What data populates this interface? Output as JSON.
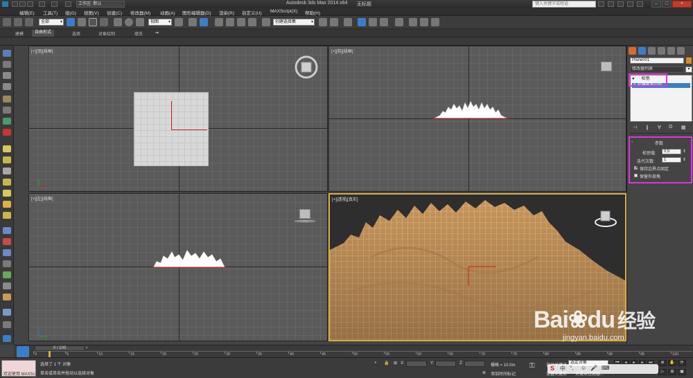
{
  "titlebar": {
    "workspace": "工作区: 默认",
    "app_title": "Autodesk 3ds Max  2014 x64",
    "doc_title": "无标题",
    "search_placeholder": "键入关键字或短语",
    "win_min": "–",
    "win_max": "□",
    "win_close": "×"
  },
  "menu": [
    "编辑(E)",
    "工具(T)",
    "组(G)",
    "视图(V)",
    "创建(C)",
    "修改器(M)",
    "动画(A)",
    "图形编辑器(D)",
    "渲染(R)",
    "自定义(U)",
    "MAXScript(X)",
    "帮助(H)"
  ],
  "toolbar": {
    "filter_select": "全部",
    "ref_coord_select": "视图",
    "named_selection_placeholder": "创建选择集"
  },
  "ribbon_tabs": [
    "建模",
    "自由形式",
    "选择",
    "对象绘制",
    "填充"
  ],
  "viewports": {
    "top": "[+][顶][线框]",
    "front": "[+][前][线框]",
    "left": "[+][左][线框]",
    "perspective": "[+][透视][真实]"
  },
  "command_panel": {
    "object_name": "Plane001",
    "modifier_list": "修改器列表",
    "stack_items": [
      "松弛",
      "可编辑多边形"
    ],
    "rollout_title": "参数",
    "relax_label": "松弛值:",
    "relax_value": "0.5",
    "iter_label": "迭代次数:",
    "iter_value": "1",
    "keep_boundary": "保持边界点固定",
    "keep_boundary_checked": true,
    "save_outer": "保留外部角",
    "save_outer_checked": false,
    "highlight_color": "#e033e0"
  },
  "timeline": {
    "frame_label": "0 / 100",
    "current_frame": 0,
    "total_frames": 100,
    "ticks": [
      "0",
      "5",
      "10",
      "15",
      "20",
      "25",
      "30",
      "35",
      "40",
      "45",
      "50",
      "55",
      "60",
      "65",
      "70",
      "75",
      "80",
      "85",
      "90",
      "95",
      "100"
    ]
  },
  "status": {
    "welcome": "欢迎使用 MAXSc",
    "selected": "选择了 1 个 对象",
    "prompt": "单击或单击并拖动以选择对象",
    "x_label": "X:",
    "y_label": "Y:",
    "z_label": "Z:",
    "grid": "栅格 = 10.0m",
    "auto_key": "自动关键点",
    "set_key": "设置关键点",
    "selected_object": "选定对象",
    "add_time_tag": "添加时间标记",
    "key_filters": "关键点过滤器..."
  },
  "watermark": {
    "brand": "Bai",
    "brand2": "du",
    "jingyan": "经验",
    "url": "jingyan.baidu.com"
  },
  "colors": {
    "terrain": "#c8955a",
    "selection_red": "#cc2222",
    "highlight": "#e033e0",
    "viewport_bg": "#5a5a5a"
  }
}
